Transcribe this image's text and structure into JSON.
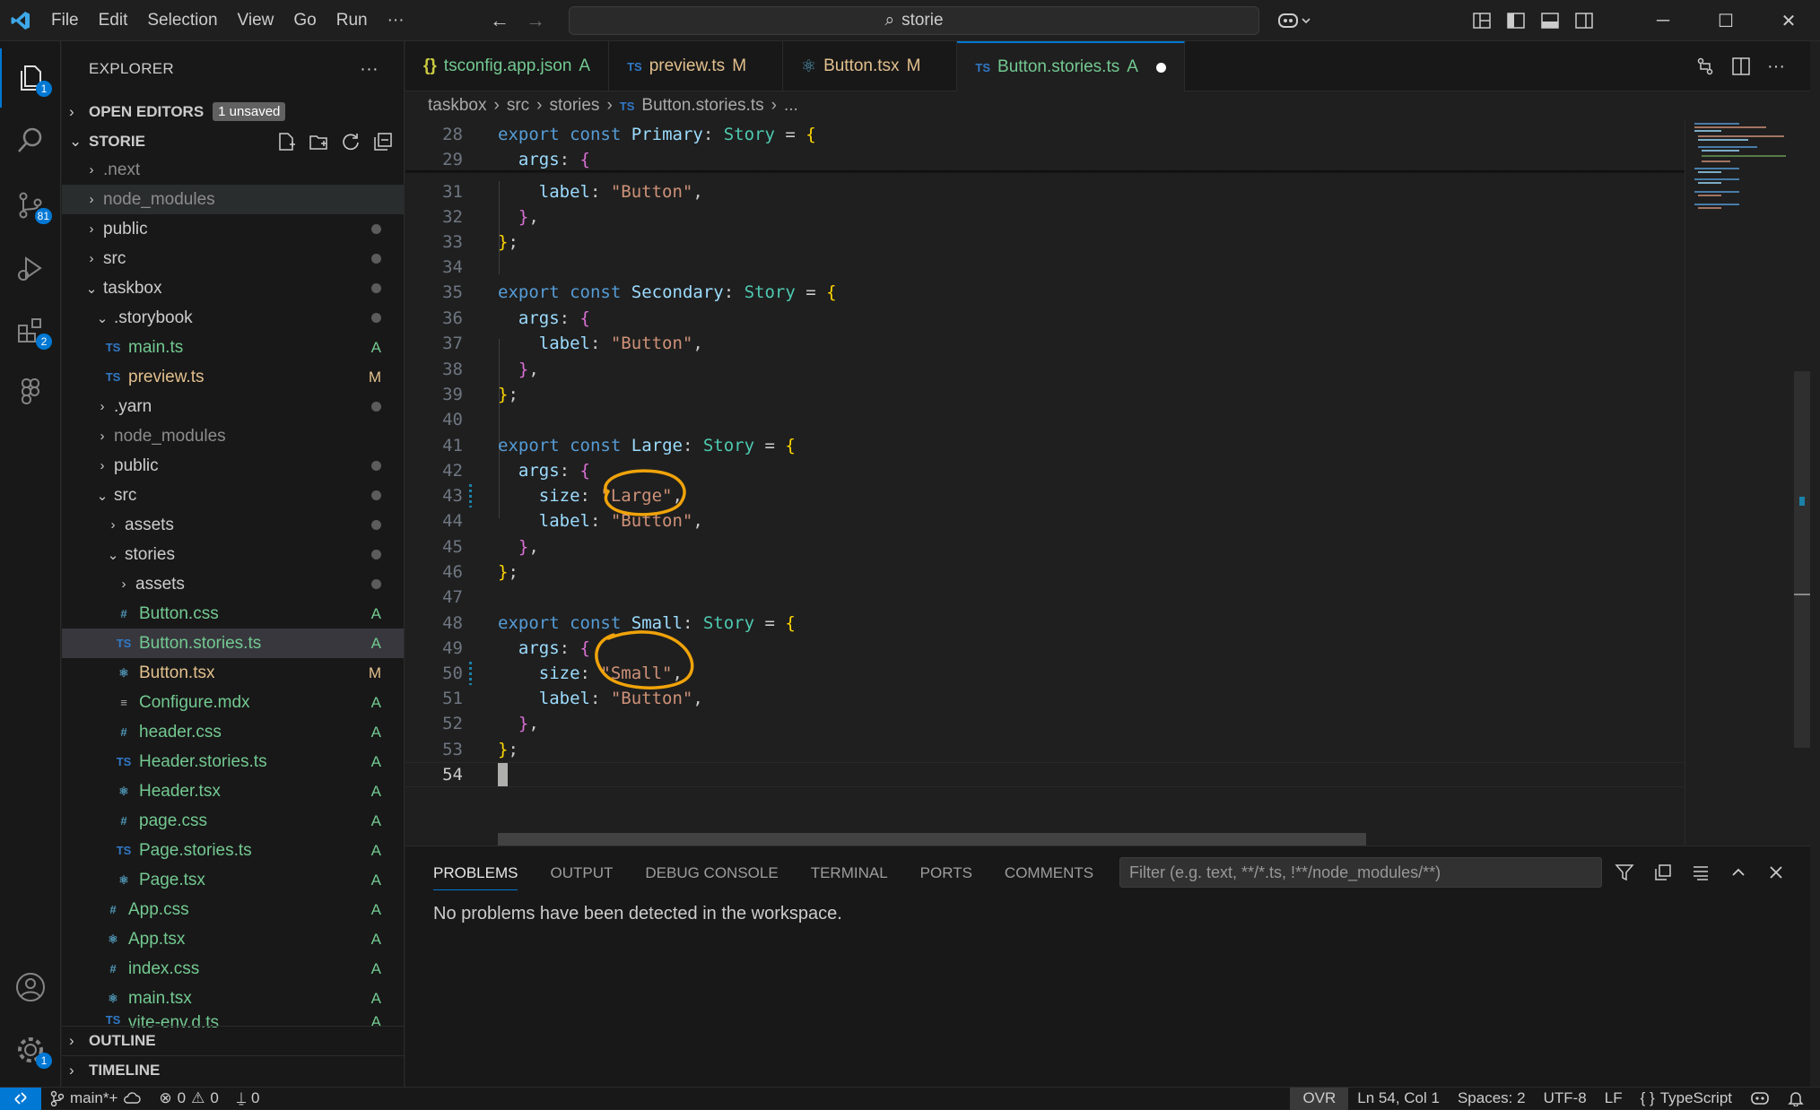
{
  "menu": [
    "File",
    "Edit",
    "Selection",
    "View",
    "Go",
    "Run",
    "···"
  ],
  "search": {
    "text": "storie"
  },
  "activity": {
    "explorer_badge": "1",
    "scm_badge": "81",
    "extensions_badge": "2",
    "settings_badge": "1"
  },
  "explorer": {
    "title": "EXPLORER",
    "more": "···",
    "open_editors": "OPEN EDITORS",
    "unsaved_badge": "1 unsaved",
    "root": "STORIE",
    "outline": "OUTLINE",
    "timeline": "TIMELINE",
    "items": [
      {
        "label": ".next",
        "status": ""
      },
      {
        "label": "node_modules",
        "status": ""
      },
      {
        "label": "public",
        "status": "●"
      },
      {
        "label": "src",
        "status": "●"
      },
      {
        "label": "taskbox",
        "status": "●"
      },
      {
        "label": ".storybook",
        "status": "●"
      },
      {
        "label": "main.ts",
        "status": "A",
        "icon": "TS"
      },
      {
        "label": "preview.ts",
        "status": "M",
        "icon": "TS"
      },
      {
        "label": ".yarn",
        "status": "●"
      },
      {
        "label": "node_modules",
        "status": ""
      },
      {
        "label": "public",
        "status": "●"
      },
      {
        "label": "src",
        "status": "●"
      },
      {
        "label": "assets",
        "status": "●"
      },
      {
        "label": "stories",
        "status": "●"
      },
      {
        "label": "assets",
        "status": "●"
      },
      {
        "label": "Button.css",
        "status": "A",
        "icon": "#"
      },
      {
        "label": "Button.stories.ts",
        "status": "A",
        "icon": "TS"
      },
      {
        "label": "Button.tsx",
        "status": "M",
        "icon": "⚛"
      },
      {
        "label": "Configure.mdx",
        "status": "A",
        "icon": "≡"
      },
      {
        "label": "header.css",
        "status": "A",
        "icon": "#"
      },
      {
        "label": "Header.stories.ts",
        "status": "A",
        "icon": "TS"
      },
      {
        "label": "Header.tsx",
        "status": "A",
        "icon": "⚛"
      },
      {
        "label": "page.css",
        "status": "A",
        "icon": "#"
      },
      {
        "label": "Page.stories.ts",
        "status": "A",
        "icon": "TS"
      },
      {
        "label": "Page.tsx",
        "status": "A",
        "icon": "⚛"
      },
      {
        "label": "App.css",
        "status": "A",
        "icon": "#"
      },
      {
        "label": "App.tsx",
        "status": "A",
        "icon": "⚛"
      },
      {
        "label": "index.css",
        "status": "A",
        "icon": "#"
      },
      {
        "label": "main.tsx",
        "status": "A",
        "icon": "⚛"
      },
      {
        "label": "vite-env.d.ts",
        "status": "A",
        "icon": "TS"
      }
    ]
  },
  "tabs": [
    {
      "icon": "{}",
      "label": "tsconfig.app.json",
      "status": "A"
    },
    {
      "icon": "TS",
      "label": "preview.ts",
      "status": "M"
    },
    {
      "icon": "⚛",
      "label": "Button.tsx",
      "status": "M"
    },
    {
      "icon": "TS",
      "label": "Button.stories.ts",
      "status": "A"
    }
  ],
  "breadcrumb": [
    "taskbox",
    "src",
    "stories",
    "TS",
    "Button.stories.ts",
    "..."
  ],
  "editor": {
    "line_numbers": [
      "28",
      "29",
      "31",
      "32",
      "33",
      "34",
      "35",
      "36",
      "37",
      "38",
      "39",
      "40",
      "41",
      "42",
      "43",
      "44",
      "45",
      "46",
      "47",
      "48",
      "49",
      "50",
      "51",
      "52",
      "53",
      "54"
    ]
  },
  "panel": {
    "tabs": [
      "PROBLEMS",
      "OUTPUT",
      "DEBUG CONSOLE",
      "TERMINAL",
      "PORTS",
      "COMMENTS"
    ],
    "filter_placeholder": "Filter (e.g. text, **/*.ts, !**/node_modules/**)",
    "message": "No problems have been detected in the workspace."
  },
  "status": {
    "branch": "main*+",
    "errors": "0",
    "warnings": "0",
    "ports": "0",
    "ovr": "OVR",
    "position": "Ln 54, Col 1",
    "spaces": "Spaces: 2",
    "encoding": "UTF-8",
    "eol": "LF",
    "language": "TypeScript"
  },
  "colors": {
    "accent": "#0078d4",
    "annotation": "#f0a30a",
    "modified": "#e2c08d",
    "added": "#73c991"
  }
}
